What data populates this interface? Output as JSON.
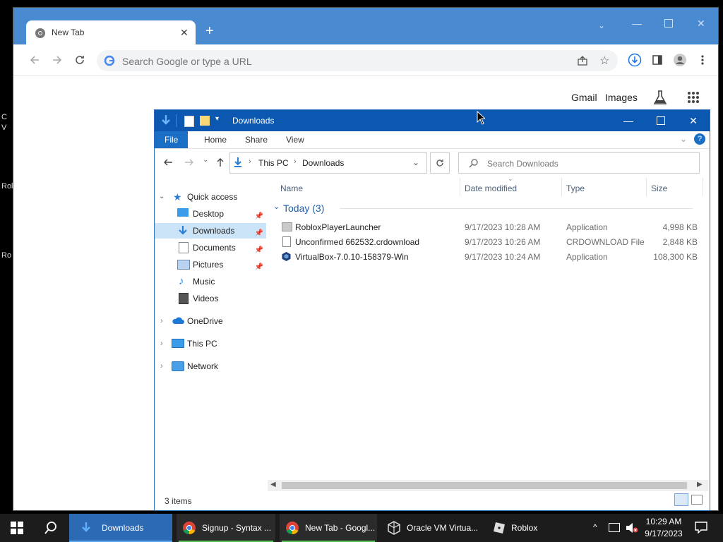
{
  "desktop": {
    "left_labels": [
      "C",
      "V",
      "Rol",
      "Ro"
    ]
  },
  "chrome": {
    "tab_title": "New Tab",
    "new_tab_symbol": "+",
    "omnibox_placeholder": "Search Google or type a URL",
    "ntp_links": {
      "gmail": "Gmail",
      "images": "Images"
    }
  },
  "explorer": {
    "title": "Downloads",
    "ribbon_tabs": [
      "File",
      "Home",
      "Share",
      "View"
    ],
    "address": {
      "root": "This PC",
      "current": "Downloads"
    },
    "search_placeholder": "Search Downloads",
    "nav": {
      "quick_access": "Quick access",
      "items": [
        {
          "label": "Desktop",
          "pinned": true
        },
        {
          "label": "Downloads",
          "pinned": true,
          "selected": true
        },
        {
          "label": "Documents",
          "pinned": true
        },
        {
          "label": "Pictures",
          "pinned": true
        },
        {
          "label": "Music",
          "pinned": false
        },
        {
          "label": "Videos",
          "pinned": false
        }
      ],
      "onedrive": "OneDrive",
      "this_pc": "This PC",
      "network": "Network"
    },
    "columns": {
      "name": "Name",
      "date": "Date modified",
      "type": "Type",
      "size": "Size"
    },
    "group_label": "Today (3)",
    "files": [
      {
        "name": "RobloxPlayerLauncher",
        "date": "9/17/2023 10:28 AM",
        "type": "Application",
        "size": "4,998 KB",
        "icon": "app-icon"
      },
      {
        "name": "Unconfirmed 662532.crdownload",
        "date": "9/17/2023 10:26 AM",
        "type": "CRDOWNLOAD File",
        "size": "2,848 KB",
        "icon": "file-icon"
      },
      {
        "name": "VirtualBox-7.0.10-158379-Win",
        "date": "9/17/2023 10:24 AM",
        "type": "Application",
        "size": "108,300 KB",
        "icon": "virtualbox-icon"
      }
    ],
    "status": "3 items"
  },
  "taskbar": {
    "items": [
      {
        "label": "Downloads",
        "icon": "folder-download-icon"
      },
      {
        "label": "Signup - Syntax ...",
        "icon": "chrome-icon"
      },
      {
        "label": "New Tab - Googl...",
        "icon": "chrome-icon"
      },
      {
        "label": "Oracle VM Virtua...",
        "icon": "virtualbox-icon"
      },
      {
        "label": "Roblox",
        "icon": "roblox-icon"
      }
    ],
    "time": "10:29 AM",
    "date": "9/17/2023"
  },
  "colors": {
    "chrome_frame": "#4a8ad0",
    "explorer_title": "#0c58b0",
    "selection": "#cce4f7",
    "taskbar": "#1c1c1c"
  }
}
